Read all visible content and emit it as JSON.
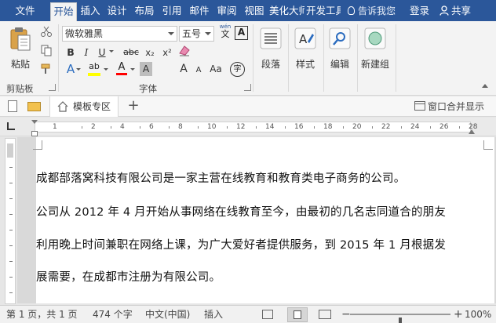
{
  "ribbon_tabs": {
    "file": "文件",
    "home": "开始",
    "insert": "插入",
    "design": "设计",
    "layout": "布局",
    "references": "引用",
    "mailings": "邮件",
    "review": "审阅",
    "view": "视图",
    "beautify": "美化大师",
    "developer": "开发工具"
  },
  "tell_me": "告诉我您",
  "login": "登录",
  "share": "共享",
  "clipboard": {
    "paste_label": "粘贴",
    "group_label": "剪贴板"
  },
  "font": {
    "font_name": "微软雅黑",
    "font_size": "五号",
    "wen_label": "wén",
    "wen_char": "文",
    "a_boxed": "A",
    "bold": "B",
    "italic": "I",
    "underline": "U",
    "strike": "abc",
    "subscript": "x₂",
    "superscript": "x²",
    "text_effect": "A",
    "highlight": "ab",
    "font_color": "A",
    "char_shading": "A",
    "grow_font": "A",
    "shrink_font": "A",
    "change_case": "Aa",
    "circled": "字",
    "group_label": "字体"
  },
  "paragraph": {
    "label": "段落"
  },
  "styles": {
    "label": "样式"
  },
  "editing": {
    "label": "编辑"
  },
  "new_group": {
    "label": "新建组"
  },
  "doc_tab": {
    "label": "模板专区"
  },
  "window_merge": "窗口合并显示",
  "ruler_numbers": [
    "1",
    "2",
    "4",
    "6",
    "8",
    "10",
    "12",
    "14",
    "16",
    "18",
    "20",
    "22",
    "24",
    "26",
    "28"
  ],
  "document": {
    "para1": "成都部落窝科技有限公司是一家主营在线教育和教育类电子商务的公司。",
    "para2_line1": "公司从 2012 年 4 月开始从事网络在线教育至今，由最初的几名志同道合的朋友",
    "para2_line2": "利用晚上时间兼职在网络上课，为广大爱好者提供服务，到 2015 年 1 月根据发",
    "para2_line3": "展需要，在成都市注册为有限公司。"
  },
  "status_bar": {
    "page": "第 1 页，共 1 页",
    "word_count": "474 个字",
    "language": "中文(中国)",
    "insert_mode": "插入",
    "zoom": "100%",
    "zoom_level": 1.0
  },
  "colors": {
    "ribbon_blue": "#2b579a",
    "highlight_yellow": "#ffff00",
    "font_red": "#ff0000",
    "accent_blue": "#2b579a"
  }
}
